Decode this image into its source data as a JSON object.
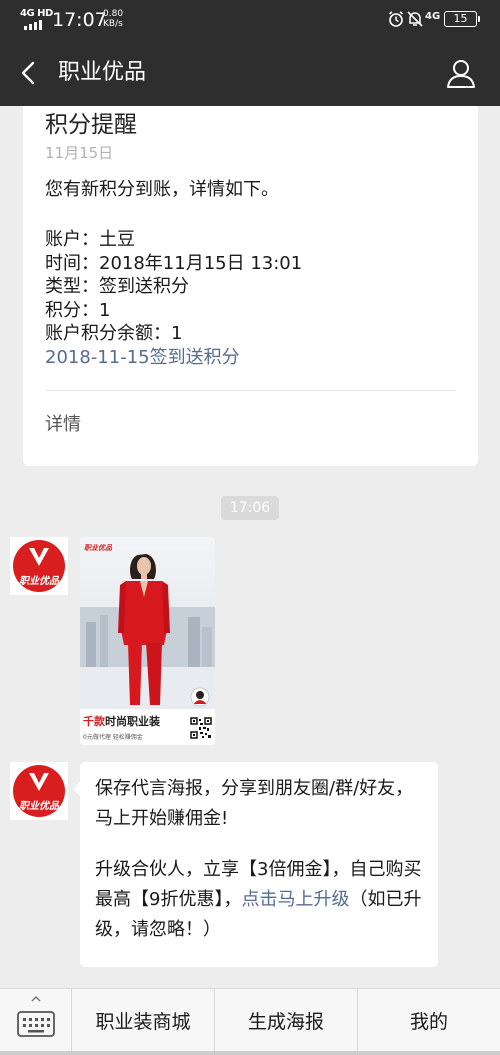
{
  "status_bar": {
    "network_type": "4G HD",
    "time": "17:07",
    "speed_value": "0.80",
    "speed_unit": "KB/s",
    "cellular": "4G",
    "battery": "15"
  },
  "nav": {
    "title": "职业优品"
  },
  "card": {
    "title": "积分提醒",
    "date": "11月15日",
    "intro": "您有新积分到账，详情如下。",
    "lines": [
      "账户：土豆",
      "时间：2018年11月15日 13:01",
      "类型：签到送积分",
      "积分：1",
      "账户积分余额：1"
    ],
    "link": "2018-11-15签到送积分",
    "detail_label": "详情"
  },
  "timestamp": "17:06",
  "avatar": {
    "text": "职业优品"
  },
  "poster": {
    "logo": "职业优品",
    "caption_red": "千款",
    "caption_rest": "时尚职业装",
    "sub": "0元做代理  轻松赚佣金"
  },
  "message": {
    "line1": "保存代言海报，分享到朋友圈/群/好友，马上开始赚佣金!",
    "line2_pre": "升级合伙人，立享【3倍佣金】，自己购买最高【9折优惠】，",
    "line2_link": "点击马上升级",
    "line2_post": "（如已升级，请忽略！）"
  },
  "menu": {
    "items": [
      "职业装商城",
      "生成海报",
      "我的"
    ]
  },
  "colors": {
    "brand_red": "#d81e1e",
    "link_blue": "#576b95",
    "header_bg": "#2e2e2e",
    "chat_bg": "#ededed"
  }
}
